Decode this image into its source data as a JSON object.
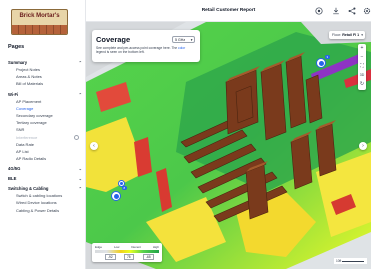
{
  "app": {
    "logo_text": "Brick Mortar's",
    "report_title": "Retail Customer Report"
  },
  "header_icons": [
    "target-icon",
    "download-icon",
    "share-icon",
    "settings-icon"
  ],
  "sidebar": {
    "pages_title": "Pages",
    "sections": [
      {
        "label": "Summary",
        "items": [
          {
            "label": "Project Notes"
          },
          {
            "label": "Areas & Notes"
          },
          {
            "label": "Bill of Materials"
          }
        ]
      },
      {
        "label": "Wi-Fi",
        "items": [
          {
            "label": "AP Placement"
          },
          {
            "label": "Coverage",
            "active": true
          },
          {
            "label": "Secondary coverage"
          },
          {
            "label": "Tertiary coverage"
          },
          {
            "label": "SNR"
          },
          {
            "label": "Interference",
            "disabled": true
          },
          {
            "label": "Data Rate"
          },
          {
            "label": "AP List"
          },
          {
            "label": "AP Radio Details"
          }
        ]
      },
      {
        "label": "4G/5G",
        "items": []
      },
      {
        "label": "BLE",
        "items": []
      },
      {
        "label": "Switching & Cabling",
        "items": [
          {
            "label": "Switch & cabling locations"
          },
          {
            "label": "Wired Device locations"
          },
          {
            "label": "Cabling & Power Details"
          }
        ]
      }
    ]
  },
  "coverage_panel": {
    "title": "Coverage",
    "band": "5 GHz",
    "desc_before": "See complete and per-access point coverage here. The ",
    "desc_link": "color",
    "desc_after": " legend is seen on the bottom left."
  },
  "floor_selector": {
    "label": "Floor:",
    "value": "Retail Fl 1"
  },
  "map_toolbar": [
    "+",
    "−",
    "⛶",
    "3D",
    "↻"
  ],
  "ap_markers": [
    {
      "badge": "3"
    },
    {
      "badge": "8"
    },
    {
      "badge": "3"
    }
  ],
  "legend": {
    "labels": [
      "Edge",
      "Low",
      "Decent",
      "High"
    ],
    "values": [
      "-92",
      "75",
      "-65"
    ],
    "colors": [
      "#d8dbde",
      "#f0d020",
      "#e7ff22",
      "#59d34e",
      "#22a34a"
    ]
  },
  "scale_label": "10ft"
}
